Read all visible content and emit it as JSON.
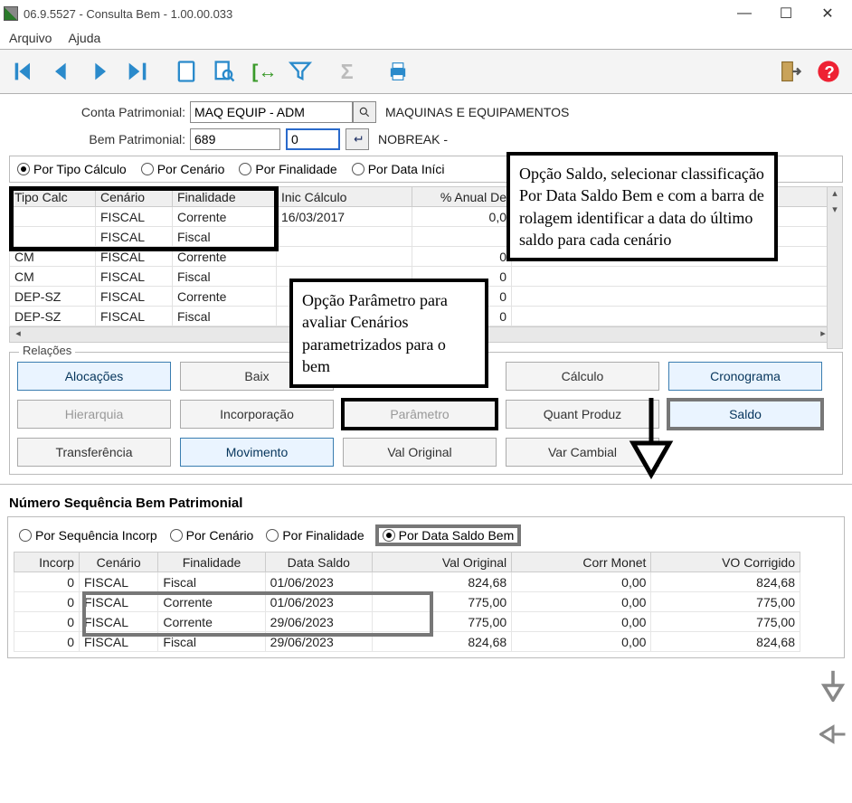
{
  "window": {
    "title": "06.9.5527 - Consulta Bem - 1.00.00.033",
    "btn_min": "—",
    "btn_max": "☐",
    "btn_close": "✕"
  },
  "menu": {
    "arquivo": "Arquivo",
    "ajuda": "Ajuda"
  },
  "form": {
    "conta_label": "Conta Patrimonial:",
    "conta_value": "MAQ EQUIP - ADM",
    "conta_desc": "MAQUINAS E EQUIPAMENTOS",
    "bem_label": "Bem Patrimonial:",
    "bem_value": "689",
    "bem_seq": "0",
    "bem_desc": "NOBREAK -"
  },
  "radios1": {
    "tipo": "Por Tipo Cálculo",
    "cenario": "Por Cenário",
    "finalidade": "Por Finalidade",
    "data": "Por Data Iníci"
  },
  "grid1": {
    "headers": {
      "tipo": "Tipo Calc",
      "cenario": "Cenário",
      "finalidade": "Finalidade",
      "inic": "Inic Cálculo",
      "anual": "% Anual De"
    },
    "rows": [
      {
        "tipo": "",
        "cenario": "FISCAL",
        "finalidade": "Corrente",
        "inic": "16/03/2017",
        "anual": "0,0"
      },
      {
        "tipo": "",
        "cenario": "FISCAL",
        "finalidade": "Fiscal",
        "inic": "",
        "anual": ""
      },
      {
        "tipo": "CM",
        "cenario": "FISCAL",
        "finalidade": "Corrente",
        "inic": "",
        "anual": "0"
      },
      {
        "tipo": "CM",
        "cenario": "FISCAL",
        "finalidade": "Fiscal",
        "inic": "",
        "anual": "0"
      },
      {
        "tipo": "DEP-SZ",
        "cenario": "FISCAL",
        "finalidade": "Corrente",
        "inic": "",
        "anual": "0"
      },
      {
        "tipo": "DEP-SZ",
        "cenario": "FISCAL",
        "finalidade": "Fiscal",
        "inic": "",
        "anual": "0"
      }
    ]
  },
  "relacoes": {
    "legend": "Relações",
    "alocacoes": "Alocações",
    "baixa": "Baix",
    "calculo": "Cálculo",
    "cronograma": "Cronograma",
    "hierarquia": "Hierarquia",
    "incorporacao": "Incorporação",
    "parametro": "Parâmetro",
    "quant": "Quant Produz",
    "saldo": "Saldo",
    "transferencia": "Transferência",
    "movimento": "Movimento",
    "valoriginal": "Val Original",
    "varcambial": "Var Cambial"
  },
  "section_title": "Número  Sequência  Bem Patrimonial",
  "radios2": {
    "seq": "Por Sequência Incorp",
    "cenario": "Por Cenário",
    "finalidade": "Por Finalidade",
    "data": "Por Data Saldo Bem"
  },
  "grid2": {
    "headers": {
      "incorp": "Incorp",
      "cenario": "Cenário",
      "finalidade": "Finalidade",
      "data": "Data Saldo",
      "val": "Val Original",
      "corr": "Corr Monet",
      "vo": "VO Corrigido"
    },
    "rows": [
      {
        "incorp": "0",
        "cenario": "FISCAL",
        "finalidade": "Fiscal",
        "data": "01/06/2023",
        "val": "824,68",
        "corr": "0,00",
        "vo": "824,68"
      },
      {
        "incorp": "0",
        "cenario": "FISCAL",
        "finalidade": "Corrente",
        "data": "01/06/2023",
        "val": "775,00",
        "corr": "0,00",
        "vo": "775,00"
      },
      {
        "incorp": "0",
        "cenario": "FISCAL",
        "finalidade": "Corrente",
        "data": "29/06/2023",
        "val": "775,00",
        "corr": "0,00",
        "vo": "775,00"
      },
      {
        "incorp": "0",
        "cenario": "FISCAL",
        "finalidade": "Fiscal",
        "data": "29/06/2023",
        "val": "824,68",
        "corr": "0,00",
        "vo": "824,68"
      }
    ]
  },
  "annotations": {
    "a1": "Opção Parâmetro para avaliar Cenários parametrizados para o bem",
    "a2": "Opção Saldo, selecionar classificação Por Data Saldo Bem e com a barra de rolagem identificar a data do último saldo para cada cenário"
  }
}
